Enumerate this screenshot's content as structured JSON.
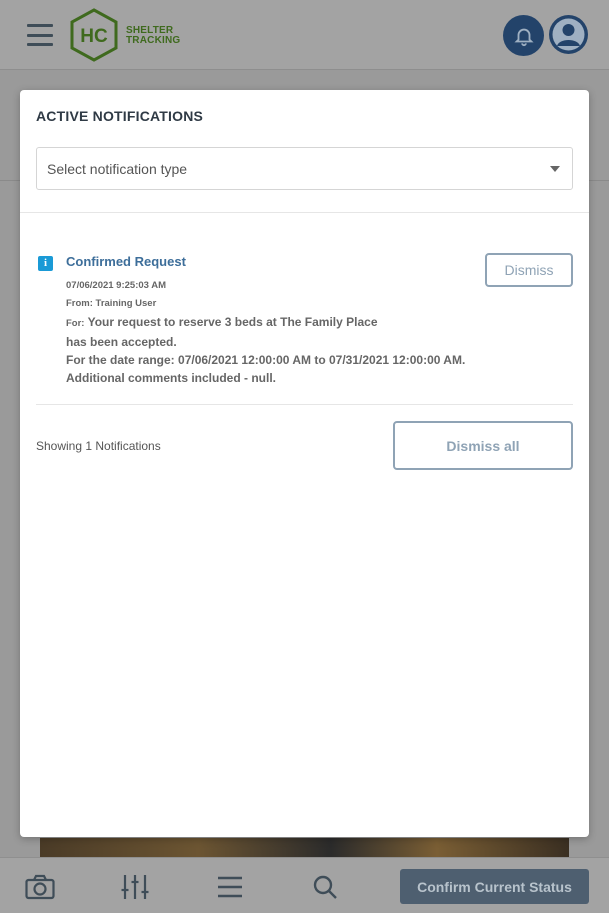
{
  "header": {
    "logo_text_line1": "SHELTER",
    "logo_text_line2": "TRACKING",
    "logo_mark": "HC",
    "icons": [
      "hamburger-icon",
      "bell-icon",
      "user-avatar-icon"
    ]
  },
  "modal": {
    "title": "ACTIVE NOTIFICATIONS",
    "select_placeholder": "Select notification type",
    "notification": {
      "icon": "info-icon",
      "title": "Confirmed Request",
      "datetime": "07/06/2021 9:25:03 AM",
      "from": "From: Training User",
      "for_label": "For:",
      "message_line1": "Your request to reserve 3 beds at The Family Place",
      "message_line2": "has been accepted.",
      "message_line3": "For the date range: 07/06/2021 12:00:00 AM to 07/31/2021 12:00:00 AM.",
      "message_line4": "Additional comments included - null.",
      "dismiss_label": "Dismiss"
    },
    "footer": {
      "showing_text": "Showing 1 Notifications",
      "dismiss_all_label": "Dismiss all"
    }
  },
  "bottom_bar": {
    "icons": [
      "camera-icon",
      "sliders-icon",
      "menu-icon",
      "search-icon"
    ],
    "confirm_label": "Confirm Current Status"
  },
  "colors": {
    "brand_navy": "#23436a",
    "brand_green": "#3f6a1e",
    "link_blue": "#3d6e9a",
    "info_blue": "#1a9ad6",
    "button_outline": "#8fa3b5"
  }
}
